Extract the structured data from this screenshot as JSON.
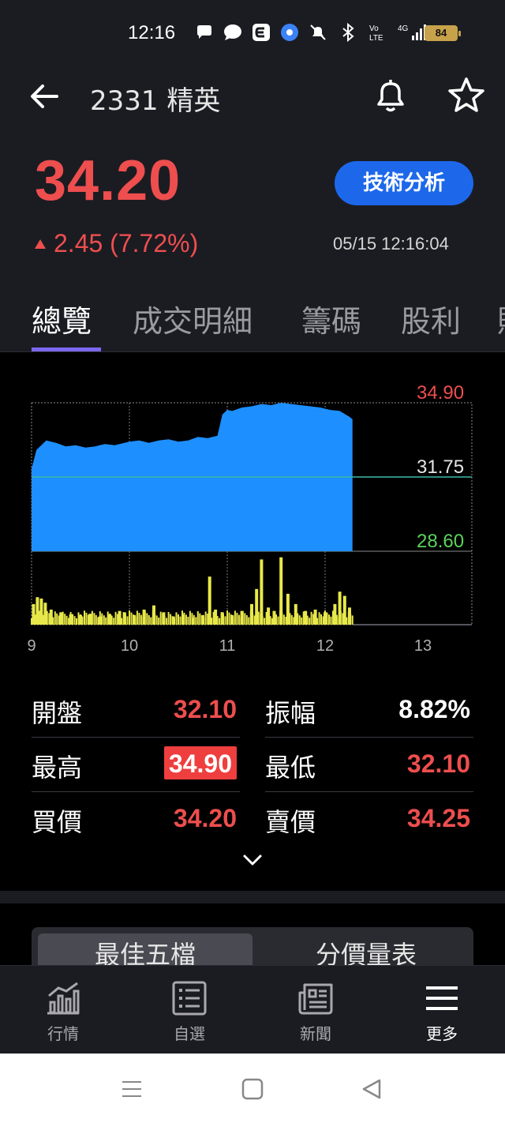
{
  "status_bar": {
    "time": "12:16",
    "battery": "84",
    "icons": [
      "speech-bubble-icon",
      "chat-icon",
      "e-app-icon",
      "chromium-icon",
      "mute-alarm-icon",
      "bluetooth-icon",
      "volte-icon",
      "4g-signal-icon"
    ]
  },
  "header": {
    "title": "2331 精英",
    "back_icon": "arrow-left-icon",
    "alert_icon": "bell-icon",
    "favorite_icon": "star-icon"
  },
  "quote": {
    "price": "34.20",
    "change": "2.45 (7.72%)",
    "datetime": "05/15 12:16:04",
    "tech_button": "技術分析"
  },
  "tabs": [
    "總覽",
    "成交明細",
    "籌碼",
    "股利",
    "財"
  ],
  "chart_data": {
    "type": "area",
    "title": "",
    "price_labels": {
      "high": "34.90",
      "reference": "31.75",
      "low": "28.60"
    },
    "ylim": [
      28.6,
      34.9
    ],
    "reference": 31.75,
    "x_ticks": [
      "9",
      "10",
      "11",
      "12",
      "13"
    ],
    "x_range_hours": [
      9,
      13.5
    ],
    "series": [
      {
        "x": [
          9.0,
          9.05,
          9.1,
          9.15,
          9.25,
          9.35,
          9.45,
          9.55,
          9.65,
          9.75,
          9.85,
          9.95,
          10.0,
          10.1,
          10.2,
          10.3,
          10.4,
          10.5,
          10.6,
          10.7,
          10.8,
          10.9,
          10.95,
          11.0,
          11.05,
          11.15,
          11.25,
          11.35,
          11.45,
          11.55,
          11.65,
          11.75,
          11.85,
          11.95,
          12.05,
          12.15,
          12.25,
          12.28
        ],
        "values": [
          32.1,
          32.9,
          33.1,
          33.3,
          33.2,
          33.05,
          33.1,
          33.0,
          33.05,
          33.15,
          33.1,
          33.2,
          33.25,
          33.3,
          33.2,
          33.3,
          33.35,
          33.25,
          33.3,
          33.45,
          33.4,
          33.5,
          34.4,
          34.6,
          34.55,
          34.7,
          34.75,
          34.85,
          34.8,
          34.9,
          34.85,
          34.8,
          34.75,
          34.7,
          34.6,
          34.55,
          34.3,
          34.2
        ]
      }
    ],
    "volume": {
      "x": [
        9.02,
        9.06,
        9.1,
        9.14,
        9.2,
        9.3,
        9.4,
        9.5,
        9.6,
        9.7,
        9.8,
        9.9,
        9.95,
        10.05,
        10.15,
        10.25,
        10.35,
        10.45,
        10.55,
        10.65,
        10.75,
        10.82,
        10.88,
        10.95,
        11.05,
        11.15,
        11.25,
        11.3,
        11.35,
        11.42,
        11.48,
        11.55,
        11.62,
        11.7,
        11.8,
        11.9,
        12.0,
        12.1,
        12.15,
        12.2,
        12.25
      ],
      "values": [
        30,
        40,
        38,
        32,
        22,
        18,
        15,
        14,
        16,
        12,
        15,
        20,
        18,
        14,
        22,
        28,
        18,
        12,
        15,
        10,
        14,
        70,
        22,
        18,
        14,
        20,
        30,
        52,
        95,
        25,
        20,
        98,
        45,
        30,
        20,
        22,
        18,
        30,
        48,
        42,
        25
      ]
    }
  },
  "stats": [
    {
      "label": "開盤",
      "value": "32.10",
      "label2": "振幅",
      "value2": "8.82%"
    },
    {
      "label": "最高",
      "value": "34.90",
      "label2": "最低",
      "value2": "32.10"
    },
    {
      "label": "買價",
      "value": "34.20",
      "label2": "賣價",
      "value2": "34.25"
    }
  ],
  "segment": {
    "option1": "最佳五檔",
    "option2": "分價量表"
  },
  "bottom_nav": [
    {
      "label": "行情",
      "icon": "chart-icon"
    },
    {
      "label": "自選",
      "icon": "list-icon"
    },
    {
      "label": "新聞",
      "icon": "news-icon"
    },
    {
      "label": "更多",
      "icon": "menu-icon"
    }
  ],
  "colors": {
    "up": "#ee4e4e",
    "down": "#5ad35a",
    "area": "#1e8fff",
    "volume": "#e8e84a",
    "accent": "#1d68ea"
  }
}
